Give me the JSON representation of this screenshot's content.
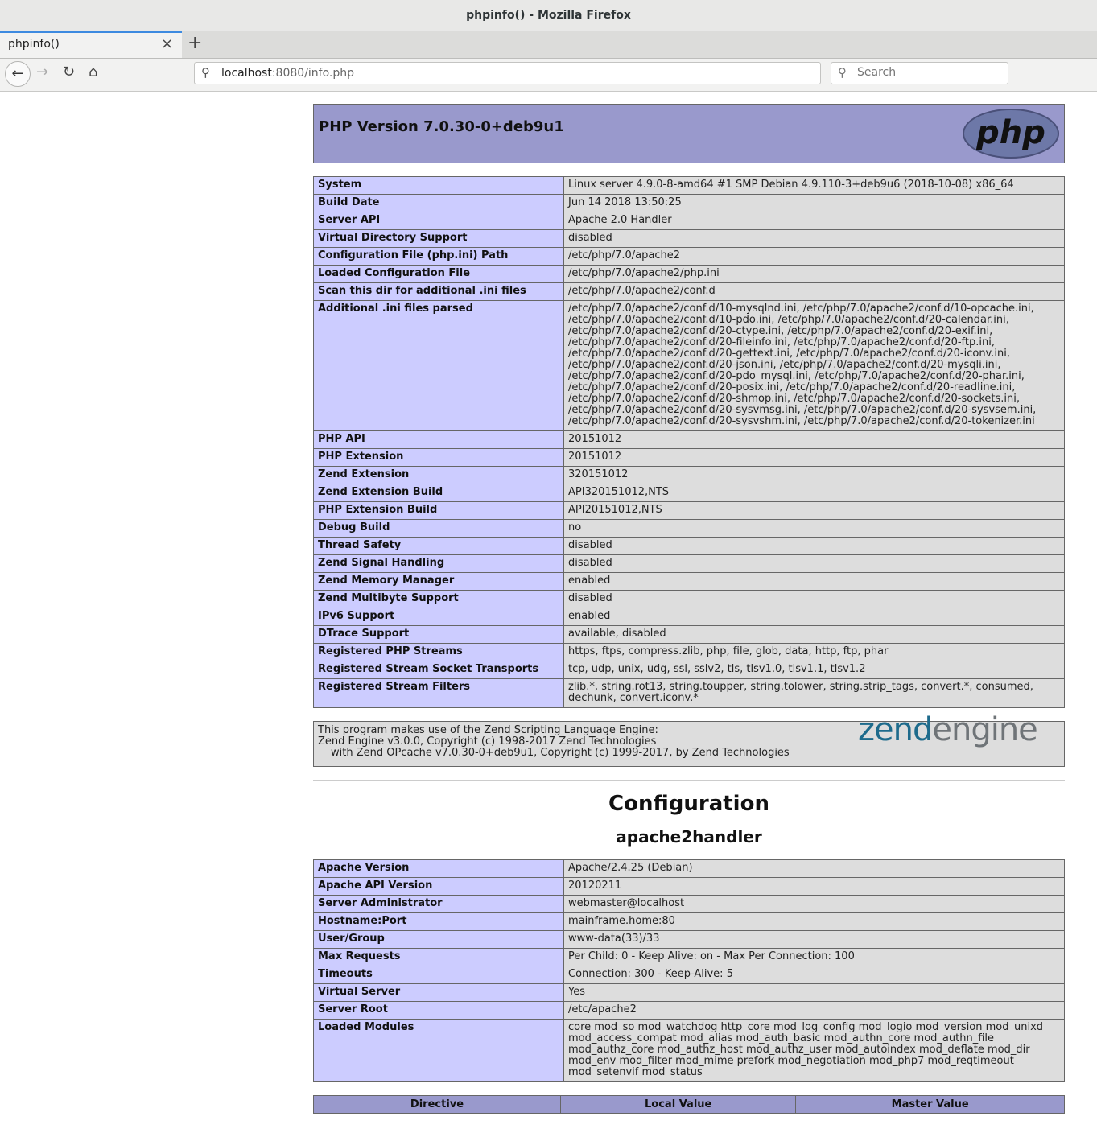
{
  "window": {
    "title": "phpinfo() - Mozilla Firefox"
  },
  "tab": {
    "title": "phpinfo()",
    "close": "×",
    "new_tab": "+"
  },
  "nav": {
    "url_host": "localhost",
    "url_path": ":8080/info.php",
    "search_placeholder": "Search"
  },
  "header": {
    "title": "PHP Version 7.0.30-0+deb9u1",
    "logo_text": "php"
  },
  "info_rows": [
    {
      "k": "System",
      "v": "Linux server 4.9.0-8-amd64 #1 SMP Debian 4.9.110-3+deb9u6 (2018-10-08) x86_64"
    },
    {
      "k": "Build Date",
      "v": "Jun 14 2018 13:50:25"
    },
    {
      "k": "Server API",
      "v": "Apache 2.0 Handler"
    },
    {
      "k": "Virtual Directory Support",
      "v": "disabled"
    },
    {
      "k": "Configuration File (php.ini) Path",
      "v": "/etc/php/7.0/apache2"
    },
    {
      "k": "Loaded Configuration File",
      "v": "/etc/php/7.0/apache2/php.ini"
    },
    {
      "k": "Scan this dir for additional .ini files",
      "v": "/etc/php/7.0/apache2/conf.d"
    },
    {
      "k": "Additional .ini files parsed",
      "v": "/etc/php/7.0/apache2/conf.d/10-mysqlnd.ini, /etc/php/7.0/apache2/conf.d/10-opcache.ini, /etc/php/7.0/apache2/conf.d/10-pdo.ini, /etc/php/7.0/apache2/conf.d/20-calendar.ini, /etc/php/7.0/apache2/conf.d/20-ctype.ini, /etc/php/7.0/apache2/conf.d/20-exif.ini, /etc/php/7.0/apache2/conf.d/20-fileinfo.ini, /etc/php/7.0/apache2/conf.d/20-ftp.ini, /etc/php/7.0/apache2/conf.d/20-gettext.ini, /etc/php/7.0/apache2/conf.d/20-iconv.ini, /etc/php/7.0/apache2/conf.d/20-json.ini, /etc/php/7.0/apache2/conf.d/20-mysqli.ini, /etc/php/7.0/apache2/conf.d/20-pdo_mysql.ini, /etc/php/7.0/apache2/conf.d/20-phar.ini, /etc/php/7.0/apache2/conf.d/20-posix.ini, /etc/php/7.0/apache2/conf.d/20-readline.ini, /etc/php/7.0/apache2/conf.d/20-shmop.ini, /etc/php/7.0/apache2/conf.d/20-sockets.ini, /etc/php/7.0/apache2/conf.d/20-sysvmsg.ini, /etc/php/7.0/apache2/conf.d/20-sysvsem.ini, /etc/php/7.0/apache2/conf.d/20-sysvshm.ini, /etc/php/7.0/apache2/conf.d/20-tokenizer.ini"
    },
    {
      "k": "PHP API",
      "v": "20151012"
    },
    {
      "k": "PHP Extension",
      "v": "20151012"
    },
    {
      "k": "Zend Extension",
      "v": "320151012"
    },
    {
      "k": "Zend Extension Build",
      "v": "API320151012,NTS"
    },
    {
      "k": "PHP Extension Build",
      "v": "API20151012,NTS"
    },
    {
      "k": "Debug Build",
      "v": "no"
    },
    {
      "k": "Thread Safety",
      "v": "disabled"
    },
    {
      "k": "Zend Signal Handling",
      "v": "disabled"
    },
    {
      "k": "Zend Memory Manager",
      "v": "enabled"
    },
    {
      "k": "Zend Multibyte Support",
      "v": "disabled"
    },
    {
      "k": "IPv6 Support",
      "v": "enabled"
    },
    {
      "k": "DTrace Support",
      "v": "available, disabled"
    },
    {
      "k": "Registered PHP Streams",
      "v": "https, ftps, compress.zlib, php, file, glob, data, http, ftp, phar"
    },
    {
      "k": "Registered Stream Socket Transports",
      "v": "tcp, udp, unix, udg, ssl, sslv2, tls, tlsv1.0, tlsv1.1, tlsv1.2"
    },
    {
      "k": "Registered Stream Filters",
      "v": "zlib.*, string.rot13, string.toupper, string.tolower, string.strip_tags, convert.*, consumed, dechunk, convert.iconv.*"
    }
  ],
  "zend": {
    "line1": "This program makes use of the Zend Scripting Language Engine:",
    "line2": "Zend Engine v3.0.0, Copyright (c) 1998-2017 Zend Technologies",
    "line3": "with Zend OPcache v7.0.30-0+deb9u1, Copyright (c) 1999-2017, by Zend Technologies",
    "logo_zend": "zend",
    "logo_engine": "engine"
  },
  "configuration": {
    "heading": "Configuration",
    "module": "apache2handler"
  },
  "apache_rows": [
    {
      "k": "Apache Version",
      "v": "Apache/2.4.25 (Debian)"
    },
    {
      "k": "Apache API Version",
      "v": "20120211"
    },
    {
      "k": "Server Administrator",
      "v": "webmaster@localhost"
    },
    {
      "k": "Hostname:Port",
      "v": "mainframe.home:80"
    },
    {
      "k": "User/Group",
      "v": "www-data(33)/33"
    },
    {
      "k": "Max Requests",
      "v": "Per Child: 0 - Keep Alive: on - Max Per Connection: 100"
    },
    {
      "k": "Timeouts",
      "v": "Connection: 300 - Keep-Alive: 5"
    },
    {
      "k": "Virtual Server",
      "v": "Yes"
    },
    {
      "k": "Server Root",
      "v": "/etc/apache2"
    },
    {
      "k": "Loaded Modules",
      "v": "core mod_so mod_watchdog http_core mod_log_config mod_logio mod_version mod_unixd mod_access_compat mod_alias mod_auth_basic mod_authn_core mod_authn_file mod_authz_core mod_authz_host mod_authz_user mod_autoindex mod_deflate mod_dir mod_env mod_filter mod_mime prefork mod_negotiation mod_php7 mod_reqtimeout mod_setenvif mod_status"
    }
  ],
  "directive_headers": [
    "Directive",
    "Local Value",
    "Master Value"
  ]
}
